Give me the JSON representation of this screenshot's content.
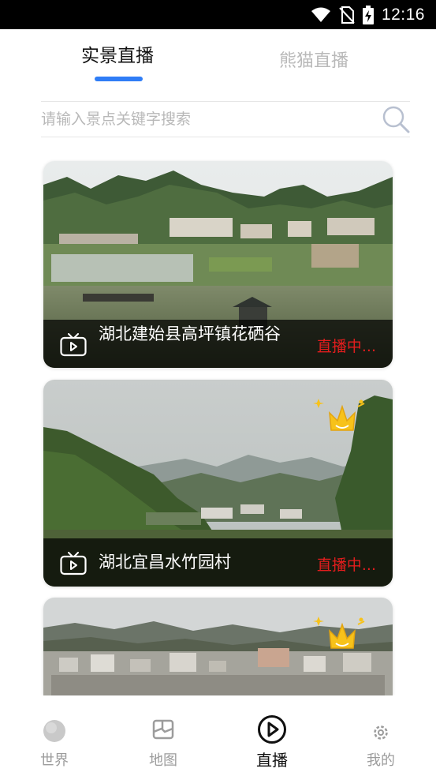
{
  "status_bar": {
    "time": "12:16",
    "icons": [
      "wifi-icon",
      "no-sim-icon",
      "battery-charging-icon"
    ]
  },
  "tabs": [
    {
      "label": "实景直播",
      "active": true
    },
    {
      "label": "熊猫直播",
      "active": false
    }
  ],
  "search": {
    "placeholder": "请输入景点关键字搜索",
    "value": ""
  },
  "cards": [
    {
      "title": "湖北建始县高坪镇花硒谷",
      "status": "直播中...",
      "vip": false
    },
    {
      "title": "湖北宜昌水竹园村",
      "status": "直播中...",
      "vip": true
    },
    {
      "title": "",
      "status": "",
      "vip": true
    }
  ],
  "bottom_nav": [
    {
      "label": "世界",
      "icon": "globe-icon",
      "active": false
    },
    {
      "label": "地图",
      "icon": "map-icon",
      "active": false
    },
    {
      "label": "直播",
      "icon": "play-circle-icon",
      "active": true
    },
    {
      "label": "我的",
      "icon": "gear-icon",
      "active": false
    }
  ],
  "colors": {
    "accent": "#2f7df6",
    "live_red": "#e21d1d",
    "inactive_text": "#b9b9b9"
  }
}
